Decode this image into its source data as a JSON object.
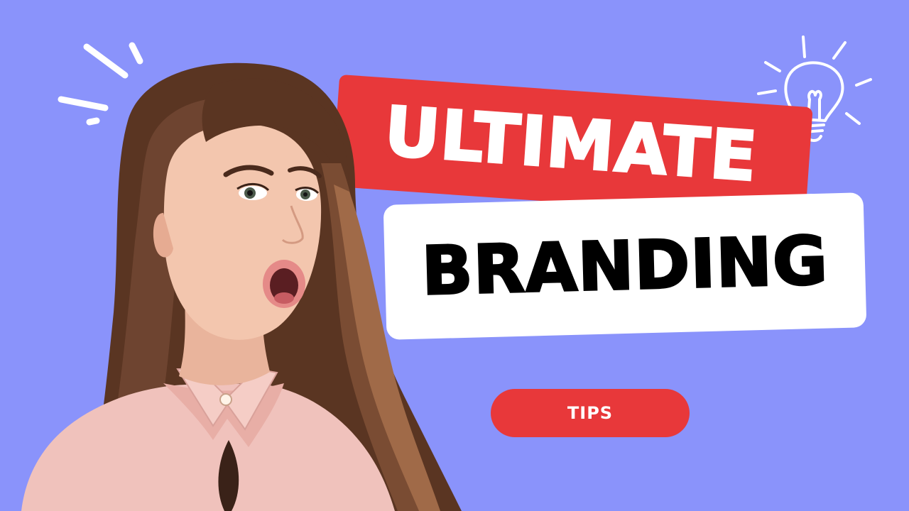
{
  "thumbnail": {
    "title_line_1": "ULTIMATE",
    "title_line_2": "BRANDING",
    "tag_label": "TIPS"
  },
  "colors": {
    "background": "#8a93fb",
    "accent_red": "#e8383a",
    "banner_white": "#ffffff",
    "title_white_text": "#ffffff",
    "title_black_text": "#000000",
    "sparkle_lines": "#ffffff"
  },
  "icons": {
    "top_left": "sparkle-lines-icon",
    "top_right": "lightbulb-idea-icon"
  },
  "photo": {
    "subject": "surprised-woman-photo"
  }
}
